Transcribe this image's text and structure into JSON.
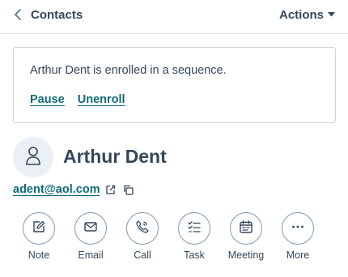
{
  "header": {
    "back_label": "Contacts",
    "actions_label": "Actions"
  },
  "banner": {
    "message": "Arthur Dent is enrolled in a sequence.",
    "pause_label": "Pause",
    "unenroll_label": "Unenroll"
  },
  "contact": {
    "name": "Arthur Dent",
    "email": "adent@aol.com"
  },
  "actions": [
    {
      "label": "Note",
      "icon": "note-icon"
    },
    {
      "label": "Email",
      "icon": "email-icon"
    },
    {
      "label": "Call",
      "icon": "call-icon"
    },
    {
      "label": "Task",
      "icon": "task-icon"
    },
    {
      "label": "Meeting",
      "icon": "meeting-icon"
    },
    {
      "label": "More",
      "icon": "more-icon"
    }
  ],
  "colors": {
    "text": "#33475b",
    "link": "#0f6b78",
    "border": "#cbd6e2",
    "avatar_bg": "#eaf0f6",
    "action_border": "#7c98b6"
  }
}
